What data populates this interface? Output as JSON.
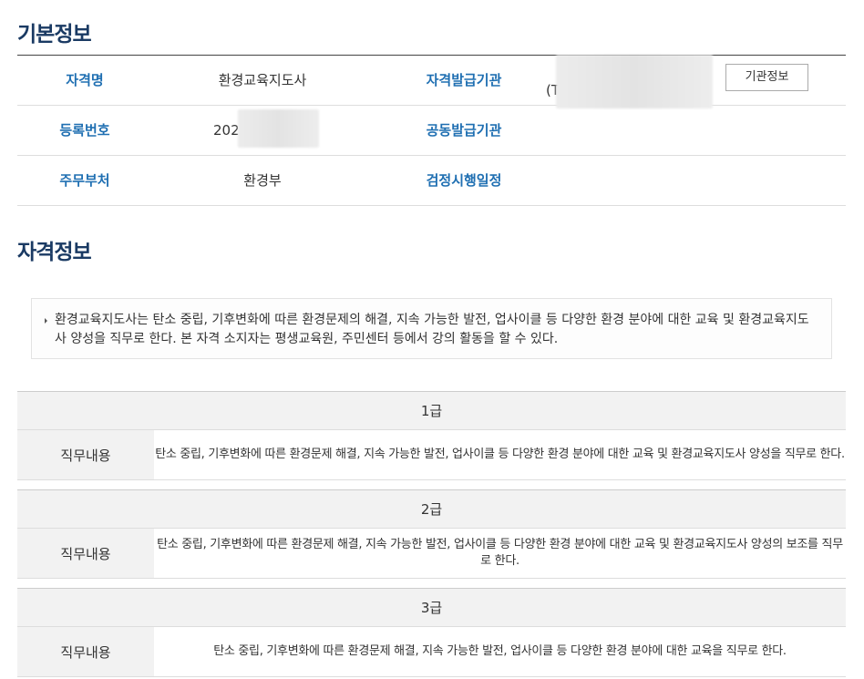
{
  "basic": {
    "title": "기본정보",
    "rows": [
      {
        "k1": "자격명",
        "v1": "환경교육지도사",
        "k2": "자격발급기관"
      },
      {
        "k1": "등록번호",
        "v1_prefix": "202",
        "k2": "공동발급기관"
      },
      {
        "k1": "주무부처",
        "v1": "환경부",
        "k2": "검정시행일정"
      }
    ],
    "issuer_paren": "(T",
    "org_button": "기관정보"
  },
  "qual": {
    "title": "자격정보",
    "description": "환경교육지도사는 탄소 중립, 기후변화에 따른 환경문제의 해결, 지속 가능한 발전, 업사이클 등 다양한 환경 분야에 대한 교육 및 환경교육지도사 양성을 직무로 한다. 본 자격 소지자는 평생교육원, 주민센터 등에서 강의 활동을 할 수 있다.",
    "grades": [
      {
        "name": "1급",
        "label": "직무내용",
        "text": "탄소 중립, 기후변화에 따른 환경문제 해결, 지속 가능한 발전, 업사이클 등 다양한 환경 분야에 대한 교육 및 환경교육지도사 양성을 직무로 한다."
      },
      {
        "name": "2급",
        "label": "직무내용",
        "text": "탄소 중립, 기후변화에 따른 환경문제 해결, 지속 가능한 발전, 업사이클 등 다양한 환경 분야에 대한 교육 및 환경교육지도사 양성의 보조를 직무로 한다."
      },
      {
        "name": "3급",
        "label": "직무내용",
        "text": "탄소 중립, 기후변화에 따른 환경문제 해결, 지속 가능한 발전, 업사이클 등 다양한 환경 분야에 대한 교육을 직무로 한다."
      }
    ]
  }
}
